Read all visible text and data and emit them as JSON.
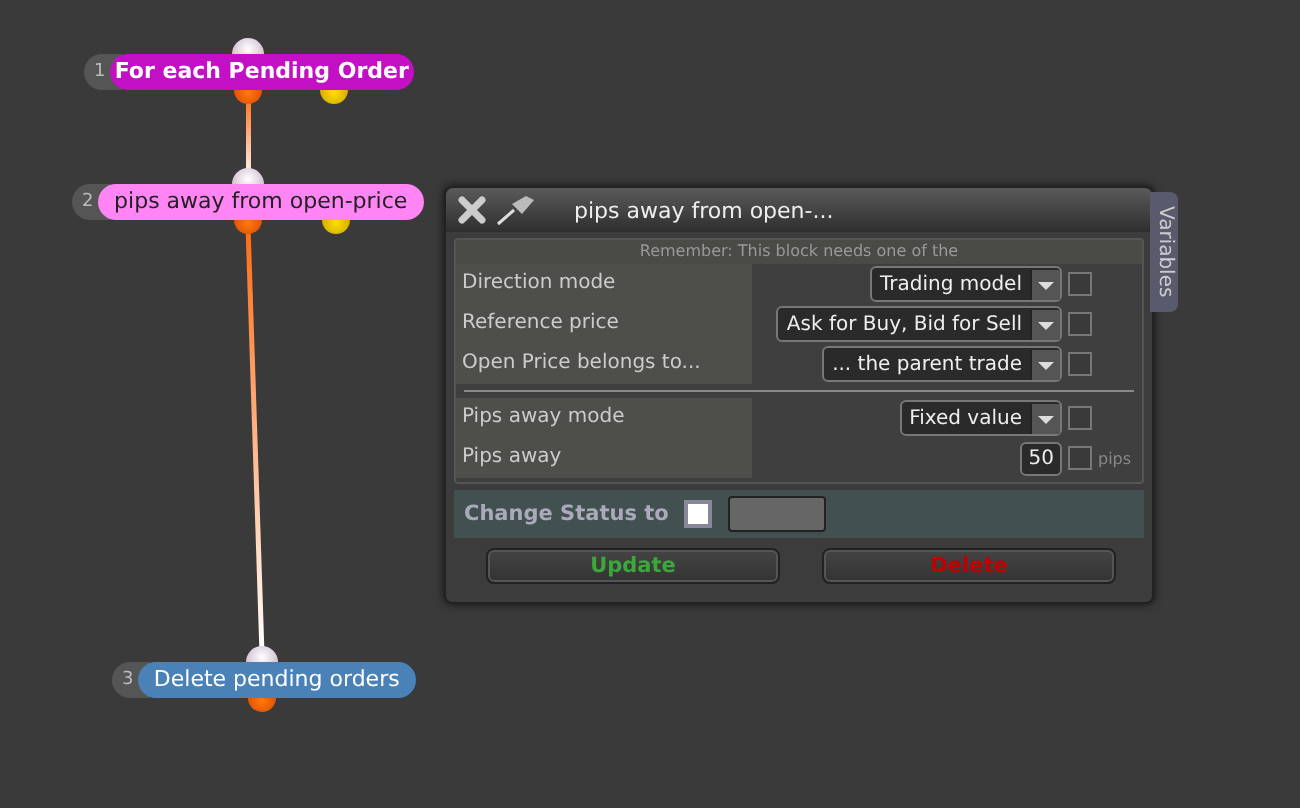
{
  "nodes": [
    {
      "number": "1",
      "label": "For each Pending Order",
      "color": "#c410c4",
      "bold": true,
      "has_yellow": true
    },
    {
      "number": "2",
      "label": "pips away from open-price",
      "color": "#ff84f4",
      "bold": false,
      "has_yellow": true
    },
    {
      "number": "3",
      "label": "Delete pending orders",
      "color": "#4a82b8",
      "bold": false,
      "has_yellow": false
    }
  ],
  "panel": {
    "title": "pips away from open-...",
    "side_tab": "Variables",
    "notice": "Remember: This block needs one of the",
    "groups": [
      [
        {
          "label": "Direction mode",
          "kind": "select",
          "value": "Trading model",
          "checked": false
        },
        {
          "label": "Reference price",
          "kind": "select",
          "value": "Ask for Buy, Bid for Sell",
          "checked": false
        },
        {
          "label": "Open Price belongs to...",
          "kind": "select",
          "value": "... the parent trade",
          "checked": false
        }
      ],
      [
        {
          "label": "Pips away mode",
          "kind": "select",
          "value": "Fixed value",
          "checked": false
        },
        {
          "label": "Pips away",
          "kind": "number",
          "value": "50",
          "checked": false,
          "unit": "pips"
        }
      ]
    ],
    "status": {
      "label": "Change Status to",
      "checked": false
    },
    "buttons": [
      {
        "label": "Update",
        "kind": "update"
      },
      {
        "label": "Delete",
        "kind": "delete"
      }
    ]
  }
}
